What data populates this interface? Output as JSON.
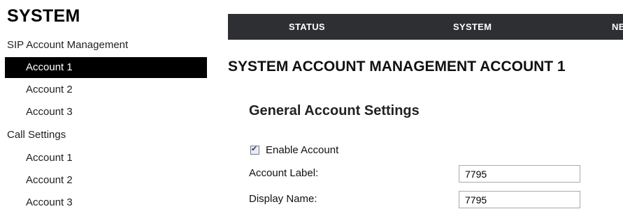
{
  "sidebar": {
    "title": "SYSTEM",
    "groups": [
      {
        "label": "SIP Account Management",
        "items": [
          {
            "label": "Account 1",
            "active": true
          },
          {
            "label": "Account 2",
            "active": false
          },
          {
            "label": "Account 3",
            "active": false
          }
        ]
      },
      {
        "label": "Call Settings",
        "items": [
          {
            "label": "Account 1",
            "active": false
          },
          {
            "label": "Account 2",
            "active": false
          },
          {
            "label": "Account 3",
            "active": false
          }
        ]
      }
    ]
  },
  "topnav": {
    "tabs": [
      {
        "label": "STATUS"
      },
      {
        "label": "SYSTEM"
      },
      {
        "label": "NE"
      }
    ]
  },
  "main": {
    "page_title": "SYSTEM ACCOUNT MANAGEMENT ACCOUNT 1",
    "section_title": "General Account Settings",
    "enable_account": {
      "label": "Enable Account",
      "checked": true
    },
    "fields": {
      "account_label": {
        "label": "Account Label:",
        "value": "7795"
      },
      "display_name": {
        "label": "Display Name:",
        "value": "7795"
      }
    }
  },
  "colors": {
    "nav_bar": "#2d2f33",
    "active_item_bg": "#000000",
    "active_item_text": "#ffffff"
  }
}
